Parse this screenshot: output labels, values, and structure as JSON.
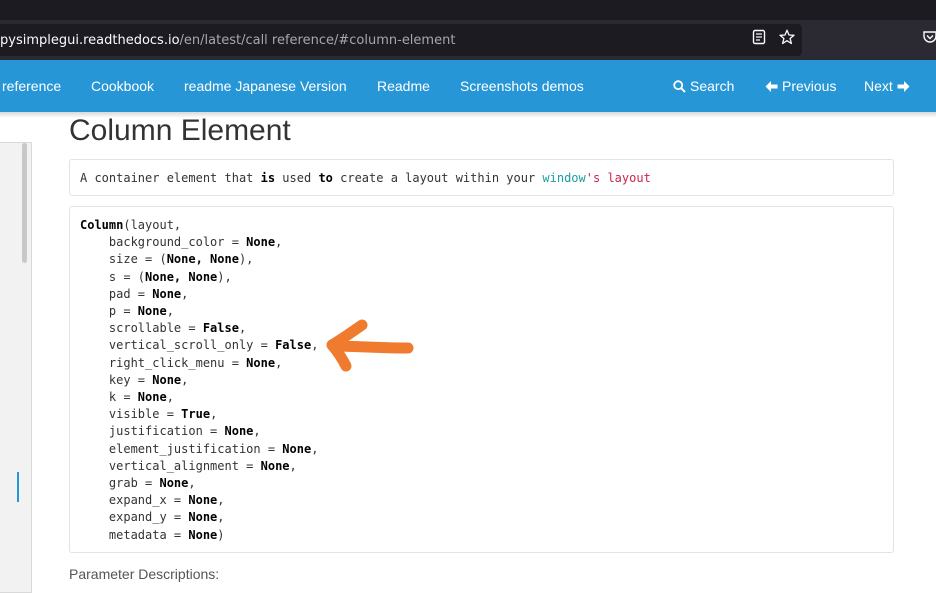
{
  "browser": {
    "url_domain": "pysimplegui.readthedocs.io",
    "url_path": "/en/latest/call reference/#column-element",
    "icons": [
      "reader-view-icon",
      "bookmark-star-icon",
      "pocket-icon"
    ]
  },
  "nav": {
    "active_label": "reference",
    "cookbook_label": "Cookbook",
    "readme_jp_label": "readme Japanese Version",
    "readme_label": "Readme",
    "screenshots_label": "Screenshots demos",
    "search_label": "Search",
    "previous_label": "Previous",
    "next_label": "Next"
  },
  "content": {
    "title": "Column Element",
    "description": {
      "p1": "A container element that ",
      "b1": "is",
      "p2": " used ",
      "b2": "to",
      "p3": " create a layout within your ",
      "teal": "window",
      "red": "'s layout"
    },
    "signature": {
      "func": "Column",
      "lines": [
        {
          "pre": "(layout,",
          "val": "",
          "post": ""
        },
        {
          "pre": "    background_color = ",
          "val": "None",
          "post": ","
        },
        {
          "pre": "    size = (",
          "val": "None, None",
          "post": "),"
        },
        {
          "pre": "    s = (",
          "val": "None, None",
          "post": "),"
        },
        {
          "pre": "    pad = ",
          "val": "None",
          "post": ","
        },
        {
          "pre": "    p = ",
          "val": "None",
          "post": ","
        },
        {
          "pre": "    scrollable = ",
          "val": "False",
          "post": ","
        },
        {
          "pre": "    vertical_scroll_only = ",
          "val": "False",
          "post": ","
        },
        {
          "pre": "    right_click_menu = ",
          "val": "None",
          "post": ","
        },
        {
          "pre": "    key = ",
          "val": "None",
          "post": ","
        },
        {
          "pre": "    k = ",
          "val": "None",
          "post": ","
        },
        {
          "pre": "    visible = ",
          "val": "True",
          "post": ","
        },
        {
          "pre": "    justification = ",
          "val": "None",
          "post": ","
        },
        {
          "pre": "    element_justification = ",
          "val": "None",
          "post": ","
        },
        {
          "pre": "    vertical_alignment = ",
          "val": "None",
          "post": ","
        },
        {
          "pre": "    grab = ",
          "val": "None",
          "post": ","
        },
        {
          "pre": "    expand_x = ",
          "val": "None",
          "post": ","
        },
        {
          "pre": "    expand_y = ",
          "val": "None",
          "post": ","
        },
        {
          "pre": "    metadata = ",
          "val": "None",
          "post": ")"
        }
      ]
    },
    "parameter_heading": "Parameter Descriptions:",
    "annotation_color": "#f07a2e"
  }
}
